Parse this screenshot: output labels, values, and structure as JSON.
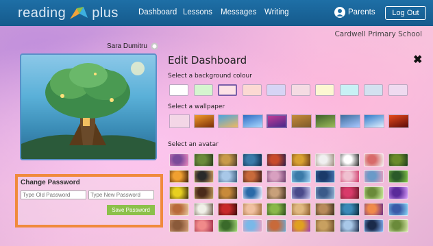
{
  "brand": {
    "left": "reading",
    "right": "plus"
  },
  "nav": {
    "items": [
      "Dashboard",
      "Lessons",
      "Messages",
      "Writing"
    ]
  },
  "user_menu": {
    "parents": "Parents",
    "logout": "Log Out"
  },
  "school": "Cardwell Primary School",
  "student": {
    "name": "Sara Dumitru"
  },
  "password": {
    "title": "Change Password",
    "old_placeholder": "Type Old Password",
    "new_placeholder": "Type New Password",
    "save": "Save Password"
  },
  "edit": {
    "title": "Edit Dashboard",
    "close": "✖",
    "bg_label": "Select a background colour",
    "wall_label": "Select a wallpaper",
    "avatar_label": "Select an avatar"
  },
  "background_colours": [
    "#ffffff",
    "#d5f5cf",
    "#fde2e6",
    "#fcd9d3",
    "#d6d4f5",
    "#f5dbe3",
    "#fdf7d2",
    "#c8f1f5",
    "#d3e1f0",
    "#efdaf0"
  ],
  "selected_background": 2,
  "wallpapers": [
    [
      "#f3d6e6",
      "#f3d6e6"
    ],
    [
      "#f29a2a",
      "#7a2e08"
    ],
    [
      "#4aa3e0",
      "#f0b860"
    ],
    [
      "#2e6cc4",
      "#a9d8ff"
    ],
    [
      "#c23a96",
      "#4a2a8a"
    ],
    [
      "#c68b3a",
      "#7d5a2a"
    ],
    [
      "#3e5f2a",
      "#9cbc5a"
    ],
    [
      "#3d6c9e",
      "#a8c8ff"
    ],
    [
      "#2f79c8",
      "#e0f0ff"
    ],
    [
      "#e84a1a",
      "#5a0a0a"
    ]
  ],
  "selected_wallpaper": 4,
  "avatars": [
    [
      "#7a4a9a",
      "#f08ac0"
    ],
    [
      "#6a8a3a",
      "#2a3a1a"
    ],
    [
      "#c89a4a",
      "#4a3a2a"
    ],
    [
      "#3a7aa8",
      "#0a2a4a"
    ],
    [
      "#c84a2a",
      "#2a1a4a"
    ],
    [
      "#d8a030",
      "#6a3a1a"
    ],
    [
      "#f0f0f0",
      "#9a8a7a"
    ],
    [
      "#ffffff",
      "#2a2a2a"
    ],
    [
      "#d86a6a",
      "#f0f0f0"
    ],
    [
      "#6a8a2a",
      "#1a3a1a"
    ],
    [
      "#f0a030",
      "#3a1a0a"
    ],
    [
      "#2a2a2a",
      "#d8a060"
    ],
    [
      "#a8c8e8",
      "#3a5a7a"
    ],
    [
      "#c86a3a",
      "#3a1a1a"
    ],
    [
      "#d8a0c0",
      "#6a3a6a"
    ],
    [
      "#3a7aa8",
      "#a8d8f8"
    ],
    [
      "#1a3a6a",
      "#4a7ab8"
    ],
    [
      "#f0c0d0",
      "#d03a6a"
    ],
    [
      "#6a9ac8",
      "#f0a0c0"
    ],
    [
      "#2a5a2a",
      "#8ac84a"
    ],
    [
      "#e8d020",
      "#3a2a0a"
    ],
    [
      "#4a2a1a",
      "#c8a060"
    ],
    [
      "#c88a3a",
      "#3a2a1a"
    ],
    [
      "#2a6aa8",
      "#f0f0ff"
    ],
    [
      "#c8a07a",
      "#3a2a1a"
    ],
    [
      "#4a4a8a",
      "#c8c8f0"
    ],
    [
      "#3a5a8a",
      "#9ab8d8"
    ],
    [
      "#d83a6a",
      "#6a1a2a"
    ],
    [
      "#6a8a3a",
      "#d0f0a0"
    ],
    [
      "#5a2a9a",
      "#e0a0ff"
    ],
    [
      "#b86a3a",
      "#e8c8a0"
    ],
    [
      "#f0f0e8",
      "#6a5a4a"
    ],
    [
      "#c82a2a",
      "#3a0a0a"
    ],
    [
      "#f0c0a0",
      "#a06a3a"
    ],
    [
      "#8ab84a",
      "#2a4a1a"
    ],
    [
      "#e0b880",
      "#8a5a2a"
    ],
    [
      "#b88a5a",
      "#3a2a1a"
    ],
    [
      "#3a8ab8",
      "#0a2a3a"
    ],
    [
      "#f08a4a",
      "#6a2a8a"
    ],
    [
      "#3a5aa8",
      "#8ad8f8"
    ],
    [
      "#8a5a3a",
      "#d8a07a"
    ],
    [
      "#f08a8a",
      "#a02a4a"
    ],
    [
      "#3a6a2a",
      "#a8d878"
    ],
    [
      "#7ab8e8",
      "#f0a0c0"
    ],
    [
      "#c86a3a",
      "#6aa8d8"
    ],
    [
      "#e0a020",
      "#a03ab8"
    ],
    [
      "#c8a060",
      "#6a4a2a"
    ],
    [
      "#a8c8e8",
      "#1a2a4a"
    ],
    [
      "#1a2a4a",
      "#8ab8ff"
    ],
    [
      "#6a8a3a",
      "#d8e8a8"
    ]
  ]
}
